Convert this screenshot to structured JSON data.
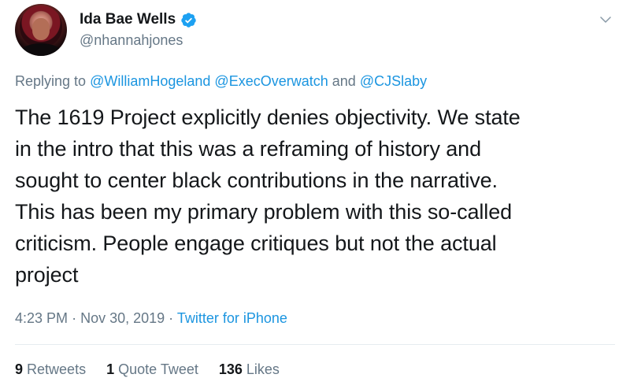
{
  "user": {
    "display_name": "Ida Bae Wells",
    "handle": "@nhannahjones",
    "verified": true,
    "avatar_icon": "profile-photo"
  },
  "reply": {
    "prefix": "Replying to",
    "mention_1": "@WilliamHogeland",
    "mention_2": "@ExecOverwatch",
    "conjunction": "and",
    "mention_3": "@CJSlaby"
  },
  "tweet": {
    "text": "The 1619 Project explicitly denies objectivity. We state\nin the intro that this was a reframing of history and\nsought to center black contributions in the narrative.\nThis has been my primary problem with this so-called\ncriticism. People engage critiques but not the actual\nproject"
  },
  "meta": {
    "time": "4:23 PM",
    "separator": "·",
    "date": "Nov 30, 2019",
    "source": "Twitter for iPhone"
  },
  "stats": {
    "retweets_count": "9",
    "retweets_label": "Retweets",
    "quotes_count": "1",
    "quotes_label": "Quote Tweet",
    "likes_count": "136",
    "likes_label": "Likes"
  },
  "colors": {
    "link": "#1b95e0",
    "secondary_text": "#657786",
    "primary_text": "#14171a",
    "divider": "#e6ecf0"
  }
}
